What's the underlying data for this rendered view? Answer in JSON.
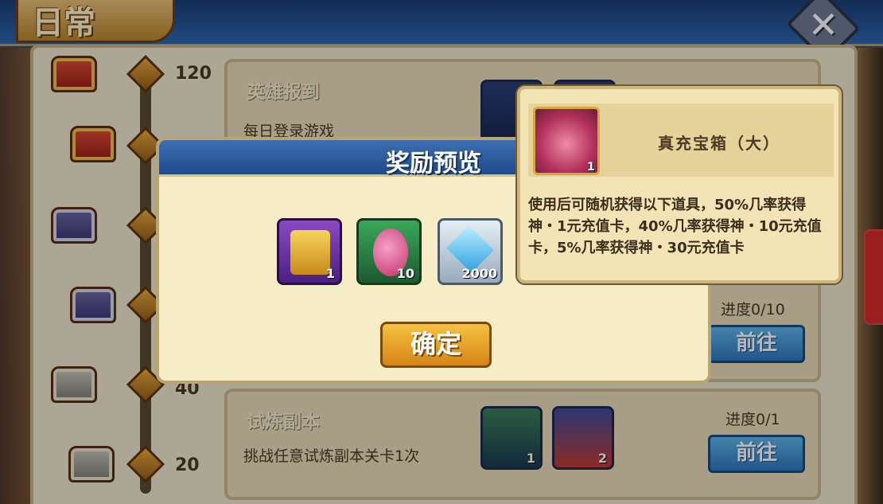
{
  "header": {
    "title": "日常"
  },
  "milestones": [
    {
      "value": "120",
      "chest": "red-chest"
    },
    {
      "value": "",
      "chest": "red-chest"
    },
    {
      "value": "",
      "chest": "purple-chest"
    },
    {
      "value": "",
      "chest": "purple-chest"
    },
    {
      "value": "40",
      "chest": "silver-chest"
    },
    {
      "value": "20",
      "chest": "silver-chest"
    }
  ],
  "tasks": [
    {
      "title": "英雄报到",
      "desc": "每日登录游戏"
    },
    {
      "progress": "进度0/10",
      "go_label": "前往"
    },
    {
      "title": "试炼副本",
      "desc": "挑战任意试炼副本关卡1次",
      "progress": "进度0/1",
      "go_label": "前往",
      "items": [
        {
          "icon": "scroll-icon",
          "count": "1"
        },
        {
          "icon": "potion-bottle-icon",
          "count": "2"
        }
      ]
    }
  ],
  "dialog": {
    "title": "奖励预览",
    "rewards": [
      {
        "icon": "golden-scroll-icon",
        "count": "1",
        "color": "#6a3aa0"
      },
      {
        "icon": "pink-egg-icon",
        "count": "10",
        "color": "#2e8a4a"
      },
      {
        "icon": "diamond-icon",
        "count": "2000",
        "color": "#c9d3dc"
      }
    ],
    "confirm_label": "确定"
  },
  "tooltip": {
    "item_name": "真充宝箱（大）",
    "icon": "red-pouch-icon",
    "count": "1",
    "description": "使用后可随机获得以下道具，50%几率获得神・1元充值卡，40%几率获得神・10元充值卡，5%几率获得神・30元充值卡"
  },
  "colors": {
    "accent_blue": "#2f78c1",
    "confirm_gold": "#f6c23f",
    "panel_bg": "#efe7cd"
  }
}
